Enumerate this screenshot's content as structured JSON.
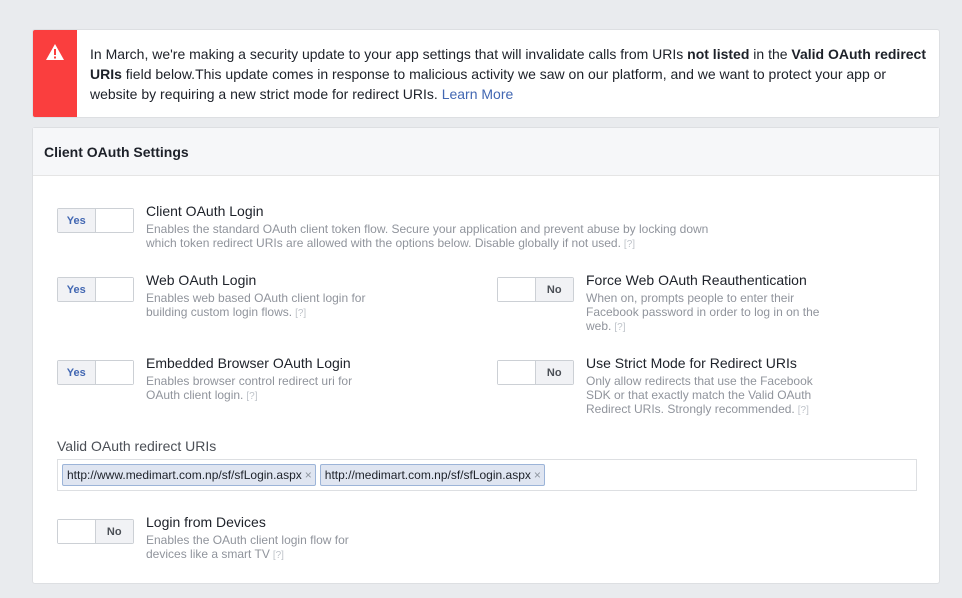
{
  "alert": {
    "icon": "warning-icon",
    "accent_color": "#fa3e3e",
    "text_part1": "In March, we're making a security update to your app settings that will invalidate calls from URIs ",
    "text_bold1": "not listed",
    "text_part2": " in the ",
    "text_bold2": "Valid OAuth redirect URIs",
    "text_part3": " field below.This update comes in response to malicious activity we saw on our platform, and we want to protect your app or website by requiring a new strict mode for redirect URIs. ",
    "learn_more": "Learn More"
  },
  "panel": {
    "title": "Client OAuth Settings"
  },
  "settings": {
    "client_oauth_login": {
      "title": "Client OAuth Login",
      "desc": "Enables the standard OAuth client token flow. Secure your application and prevent abuse by locking down which token redirect URIs are allowed with the options below. Disable globally if not used.",
      "state": "Yes"
    },
    "web_oauth_login": {
      "title": "Web OAuth Login",
      "desc": "Enables web based OAuth client login for building custom login flows.",
      "state": "Yes"
    },
    "force_web_reauth": {
      "title": "Force Web OAuth Reauthentication",
      "desc": "When on, prompts people to enter their Facebook password in order to log in on the web.",
      "state": "No"
    },
    "embedded_browser": {
      "title": "Embedded Browser OAuth Login",
      "desc": "Enables browser control redirect uri for OAuth client login.",
      "state": "Yes"
    },
    "strict_mode": {
      "title": "Use Strict Mode for Redirect URIs",
      "desc": "Only allow redirects that use the Facebook SDK or that exactly match the Valid OAuth Redirect URIs. Strongly recommended.",
      "state": "No"
    },
    "login_from_devices": {
      "title": "Login from Devices",
      "desc": "Enables the OAuth client login flow for devices like a smart TV",
      "state": "No"
    }
  },
  "help_marker": "[?]",
  "redirect_uris": {
    "label": "Valid OAuth redirect URIs",
    "tokens": [
      "http://www.medimart.com.np/sf/sfLogin.aspx",
      "http://medimart.com.np/sf/sfLogin.aspx"
    ],
    "remove_glyph": "×",
    "input_value": ""
  }
}
